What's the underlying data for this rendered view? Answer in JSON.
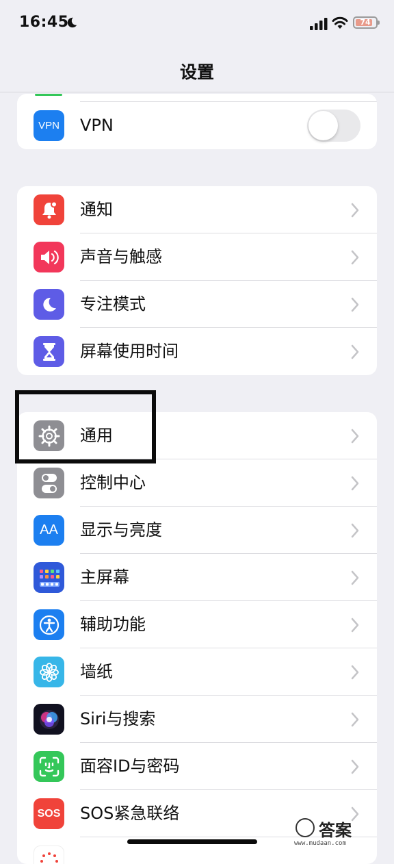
{
  "status_bar": {
    "time": "16:45",
    "battery": "74"
  },
  "nav": {
    "title": "设置"
  },
  "groups": {
    "network": {
      "vpn_icon": "VPN",
      "vpn_label": "VPN",
      "vpn_toggle": "off"
    },
    "notifications": [
      {
        "label": "通知",
        "icon": "bell-icon",
        "color": "#f0433a"
      },
      {
        "label": "声音与触感",
        "icon": "speaker-icon",
        "color": "#f2375a"
      },
      {
        "label": "专注模式",
        "icon": "moon-icon",
        "color": "#5e5ce6"
      },
      {
        "label": "屏幕使用时间",
        "icon": "hourglass-icon",
        "color": "#5e5ce6"
      }
    ],
    "general": [
      {
        "label": "通用",
        "icon": "gear-icon",
        "color": "#8e8e93"
      },
      {
        "label": "控制中心",
        "icon": "switches-icon",
        "color": "#8e8e93"
      },
      {
        "label": "显示与亮度",
        "icon_text": "AA",
        "icon": "text-size-icon",
        "color": "#1c7ff0"
      },
      {
        "label": "主屏幕",
        "icon": "home-grid-icon",
        "color": "#2f59d9"
      },
      {
        "label": "辅助功能",
        "icon": "accessibility-icon",
        "color": "#1c7ff0"
      },
      {
        "label": "墙纸",
        "icon": "flower-icon",
        "color": "#37b6e8"
      },
      {
        "label": "Siri与搜索",
        "icon": "siri-icon",
        "color": "#1a1a2e"
      },
      {
        "label": "面容ID与密码",
        "icon": "face-id-icon",
        "color": "#34c759"
      },
      {
        "label": "SOS紧急联络",
        "icon_text": "SOS",
        "icon": "sos-icon",
        "color": "#f0433a"
      }
    ]
  },
  "watermark": {
    "title": "答案",
    "url": "www.mudaan.com"
  }
}
